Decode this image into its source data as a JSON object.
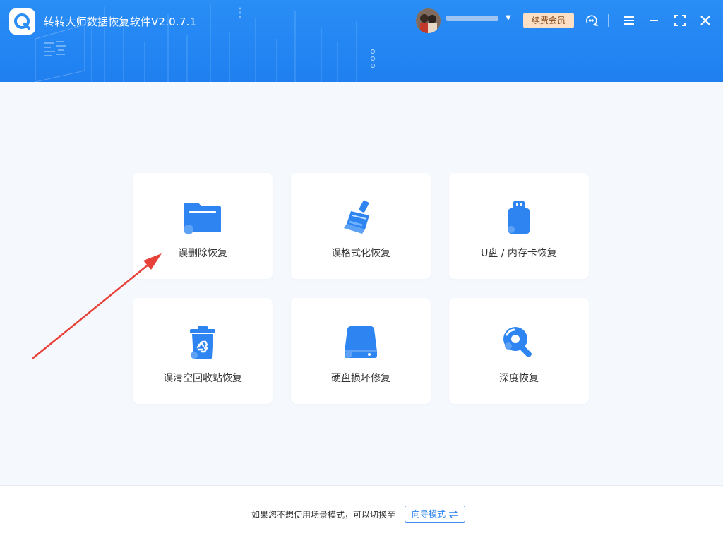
{
  "app": {
    "title": "转转大师数据恢复软件V2.0.7.1"
  },
  "header": {
    "renew_label": "续费会员",
    "icons": [
      "support-icon",
      "menu-icon",
      "minimize-icon",
      "maximize-icon",
      "close-icon"
    ]
  },
  "colors": {
    "header_blue": "#1f7ff0",
    "icon_blue": "#2e84f0",
    "renew_bg": "#fce0c6",
    "arrow_red": "#e8413a"
  },
  "cards": [
    {
      "label": "误删除恢复",
      "icon": "folder-icon"
    },
    {
      "label": "误格式化恢复",
      "icon": "broom-icon"
    },
    {
      "label": "U盘 / 内存卡恢复",
      "icon": "usb-drive-icon"
    },
    {
      "label": "误清空回收站恢复",
      "icon": "recycle-bin-icon"
    },
    {
      "label": "硬盘损坏修复",
      "icon": "hard-disk-icon"
    },
    {
      "label": "深度恢复",
      "icon": "deep-scan-icon"
    }
  ],
  "footer": {
    "text": "如果您不想使用场景模式，可以切换至",
    "guide_button": "向导模式"
  }
}
